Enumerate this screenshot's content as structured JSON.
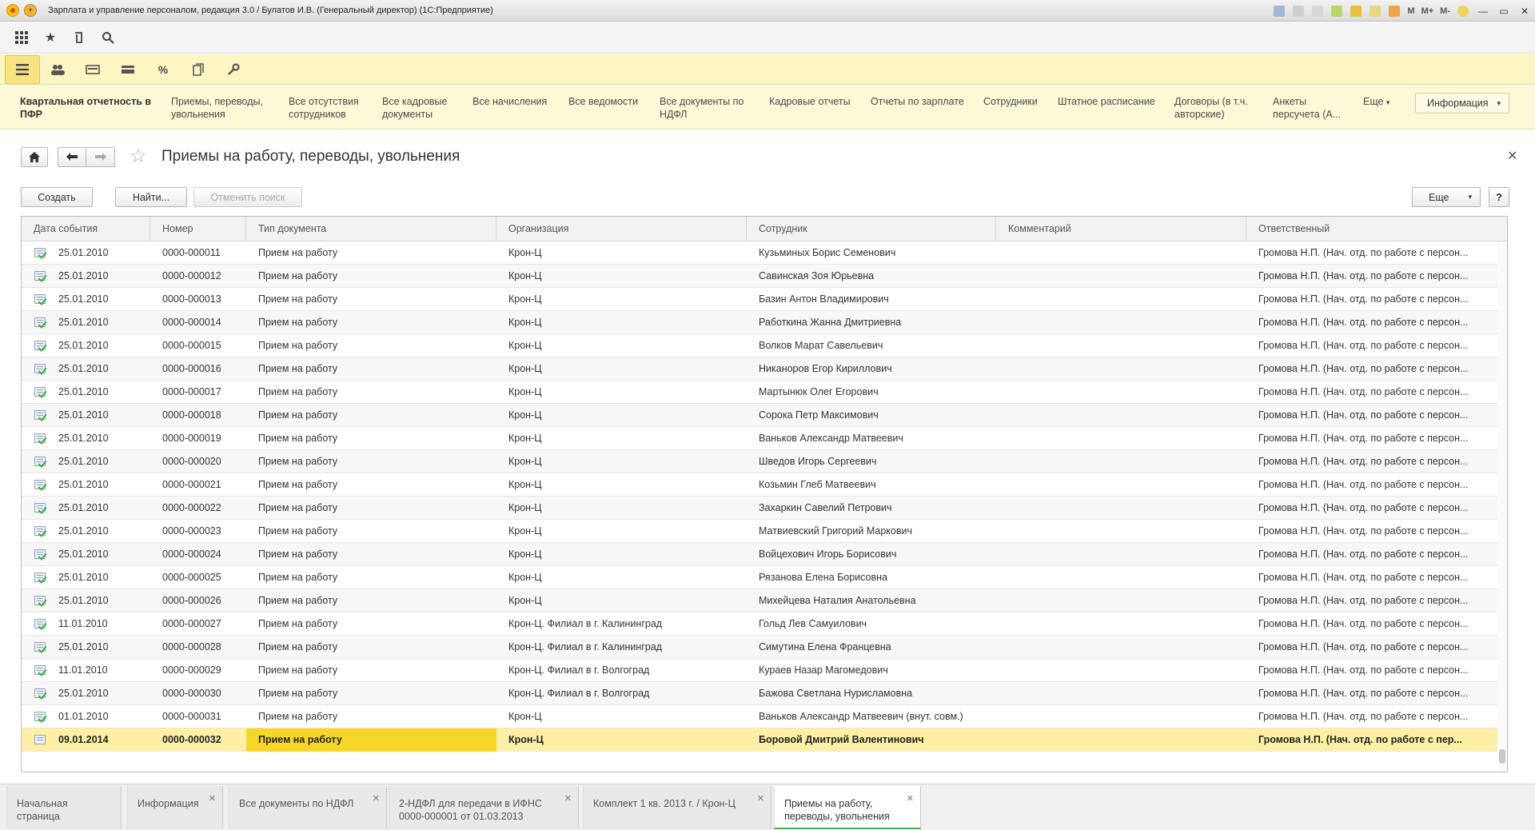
{
  "window": {
    "title": "Зарплата и управление персоналом, редакция 3.0 / Булатов И.В. (Генеральный директор)  (1С:Предприятие)",
    "right_labels": [
      "M",
      "M+",
      "M-"
    ]
  },
  "toolbar_icons": [
    "apps-grid-icon",
    "favorites-star-icon",
    "history-icon",
    "search-icon"
  ],
  "sections_icons": [
    "main-menu-icon",
    "employees-icon",
    "payroll-icon",
    "payments-icon",
    "taxes-percent-icon",
    "reports-icon",
    "settings-wrench-icon"
  ],
  "nav": {
    "items": [
      "Квартальная отчетность в ПФР",
      "Приемы, переводы, увольнения",
      "Все отсутствия сотрудников",
      "Все кадровые документы",
      "Все начисления",
      "Все ведомости",
      "Все документы по НДФЛ",
      "Кадровые отчеты",
      "Отчеты по зарплате",
      "Сотрудники",
      "Штатное расписание",
      "Договоры (в т.ч. авторские)",
      "Анкеты персучета (А...",
      "Еще"
    ],
    "info_label": "Информация"
  },
  "form": {
    "title": "Приемы на работу, переводы, увольнения",
    "create_label": "Создать",
    "find_label": "Найти...",
    "cancel_search_label": "Отменить поиск",
    "more_label": "Еще",
    "help_label": "?"
  },
  "table": {
    "columns": [
      "Дата события",
      "Номер",
      "Тип документа",
      "Организация",
      "Сотрудник",
      "Комментарий",
      "Ответственный"
    ],
    "rows": [
      {
        "date": "25.01.2010",
        "number": "0000-000011",
        "type": "Прием на работу",
        "org": "Крон-Ц",
        "employee": "Кузьминых Борис Семенович",
        "comment": "",
        "responsible": "Громова Н.П. (Нач. отд. по работе с персон..."
      },
      {
        "date": "25.01.2010",
        "number": "0000-000012",
        "type": "Прием на работу",
        "org": "Крон-Ц",
        "employee": "Савинская Зоя Юрьевна",
        "comment": "",
        "responsible": "Громова Н.П. (Нач. отд. по работе с персон..."
      },
      {
        "date": "25.01.2010",
        "number": "0000-000013",
        "type": "Прием на работу",
        "org": "Крон-Ц",
        "employee": "Базин Антон Владимирович",
        "comment": "",
        "responsible": "Громова Н.П. (Нач. отд. по работе с персон..."
      },
      {
        "date": "25.01.2010",
        "number": "0000-000014",
        "type": "Прием на работу",
        "org": "Крон-Ц",
        "employee": "Работкина Жанна Дмитриевна",
        "comment": "",
        "responsible": "Громова Н.П. (Нач. отд. по работе с персон..."
      },
      {
        "date": "25.01.2010",
        "number": "0000-000015",
        "type": "Прием на работу",
        "org": "Крон-Ц",
        "employee": "Волков Марат Савельевич",
        "comment": "",
        "responsible": "Громова Н.П. (Нач. отд. по работе с персон..."
      },
      {
        "date": "25.01.2010",
        "number": "0000-000016",
        "type": "Прием на работу",
        "org": "Крон-Ц",
        "employee": "Никаноров Егор Кириллович",
        "comment": "",
        "responsible": "Громова Н.П. (Нач. отд. по работе с персон..."
      },
      {
        "date": "25.01.2010",
        "number": "0000-000017",
        "type": "Прием на работу",
        "org": "Крон-Ц",
        "employee": "Мартынюк Олег Егорович",
        "comment": "",
        "responsible": "Громова Н.П. (Нач. отд. по работе с персон..."
      },
      {
        "date": "25.01.2010",
        "number": "0000-000018",
        "type": "Прием на работу",
        "org": "Крон-Ц",
        "employee": "Сорока Петр Максимович",
        "comment": "",
        "responsible": "Громова Н.П. (Нач. отд. по работе с персон..."
      },
      {
        "date": "25.01.2010",
        "number": "0000-000019",
        "type": "Прием на работу",
        "org": "Крон-Ц",
        "employee": "Ваньков Александр Матвеевич",
        "comment": "",
        "responsible": "Громова Н.П. (Нач. отд. по работе с персон..."
      },
      {
        "date": "25.01.2010",
        "number": "0000-000020",
        "type": "Прием на работу",
        "org": "Крон-Ц",
        "employee": "Шведов Игорь Сергеевич",
        "comment": "",
        "responsible": "Громова Н.П. (Нач. отд. по работе с персон..."
      },
      {
        "date": "25.01.2010",
        "number": "0000-000021",
        "type": "Прием на работу",
        "org": "Крон-Ц",
        "employee": "Козьмин Глеб Матвеевич",
        "comment": "",
        "responsible": "Громова Н.П. (Нач. отд. по работе с персон..."
      },
      {
        "date": "25.01.2010",
        "number": "0000-000022",
        "type": "Прием на работу",
        "org": "Крон-Ц",
        "employee": "Захаркин Савелий Петрович",
        "comment": "",
        "responsible": "Громова Н.П. (Нач. отд. по работе с персон..."
      },
      {
        "date": "25.01.2010",
        "number": "0000-000023",
        "type": "Прием на работу",
        "org": "Крон-Ц",
        "employee": "Матвиевский Григорий Маркович",
        "comment": "",
        "responsible": "Громова Н.П. (Нач. отд. по работе с персон..."
      },
      {
        "date": "25.01.2010",
        "number": "0000-000024",
        "type": "Прием на работу",
        "org": "Крон-Ц",
        "employee": "Войцехович Игорь Борисович",
        "comment": "",
        "responsible": "Громова Н.П. (Нач. отд. по работе с персон..."
      },
      {
        "date": "25.01.2010",
        "number": "0000-000025",
        "type": "Прием на работу",
        "org": "Крон-Ц",
        "employee": "Рязанова Елена Борисовна",
        "comment": "",
        "responsible": "Громова Н.П. (Нач. отд. по работе с персон..."
      },
      {
        "date": "25.01.2010",
        "number": "0000-000026",
        "type": "Прием на работу",
        "org": "Крон-Ц",
        "employee": "Михейцева Наталия Анатольевна",
        "comment": "",
        "responsible": "Громова Н.П. (Нач. отд. по работе с персон..."
      },
      {
        "date": "11.01.2010",
        "number": "0000-000027",
        "type": "Прием на работу",
        "org": "Крон-Ц. Филиал в г. Калининград",
        "employee": "Гольд Лев Самуилович",
        "comment": "",
        "responsible": "Громова Н.П. (Нач. отд. по работе с персон..."
      },
      {
        "date": "25.01.2010",
        "number": "0000-000028",
        "type": "Прием на работу",
        "org": "Крон-Ц. Филиал в г. Калининград",
        "employee": "Симутина Елена Францевна",
        "comment": "",
        "responsible": "Громова Н.П. (Нач. отд. по работе с персон..."
      },
      {
        "date": "11.01.2010",
        "number": "0000-000029",
        "type": "Прием на работу",
        "org": "Крон-Ц. Филиал в г. Волгоград",
        "employee": "Кураев Назар Магомедович",
        "comment": "",
        "responsible": "Громова Н.П. (Нач. отд. по работе с персон..."
      },
      {
        "date": "25.01.2010",
        "number": "0000-000030",
        "type": "Прием на работу",
        "org": "Крон-Ц. Филиал в г. Волгоград",
        "employee": "Бажова Светлана Нурисламовна",
        "comment": "",
        "responsible": "Громова Н.П. (Нач. отд. по работе с персон..."
      },
      {
        "date": "01.01.2010",
        "number": "0000-000031",
        "type": "Прием на работу",
        "org": "Крон-Ц",
        "employee": "Ваньков Александр Матвеевич (внут. совм.)",
        "comment": "",
        "responsible": "Громова Н.П. (Нач. отд. по работе с персон..."
      },
      {
        "date": "09.01.2014",
        "number": "0000-000032",
        "type": "Прием на работу",
        "org": "Крон-Ц",
        "employee": "Боровой Дмитрий Валентинович",
        "comment": "",
        "responsible": "Громова Н.П. (Нач. отд. по работе с пер..."
      }
    ]
  },
  "tabs": [
    {
      "label": "Начальная страница",
      "closable": false
    },
    {
      "label": "Информация",
      "closable": true
    },
    {
      "label": "Все документы по НДФЛ",
      "closable": true
    },
    {
      "label": "2-НДФЛ для передачи в ИФНС 0000-000001 от 01.03.2013",
      "closable": true
    },
    {
      "label": "Комплект 1 кв. 2013 г. / Крон-Ц",
      "closable": true
    },
    {
      "label": "Приемы на работу, переводы, увольнения",
      "closable": true
    }
  ]
}
